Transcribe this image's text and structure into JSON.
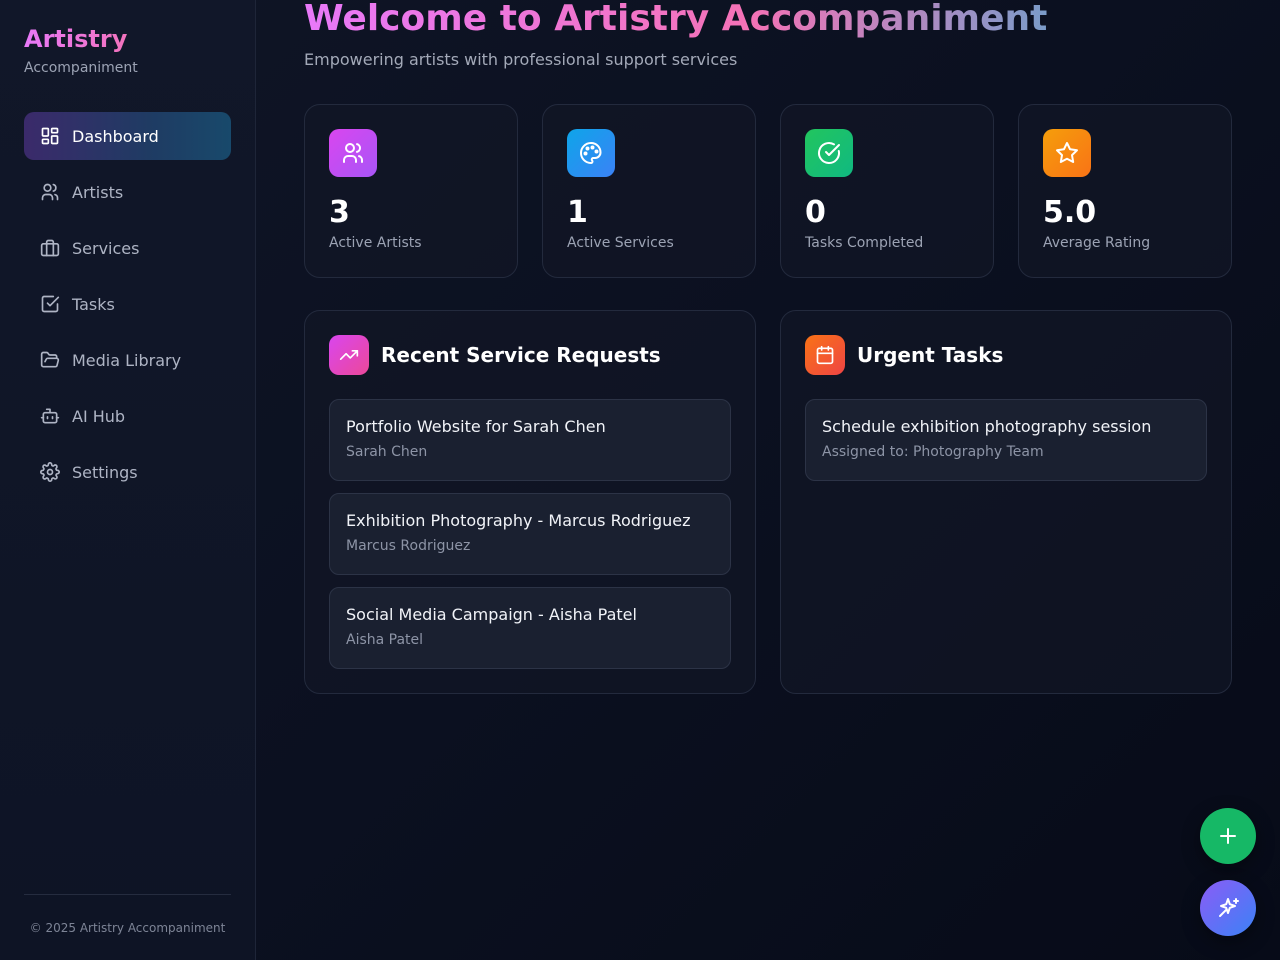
{
  "brand": {
    "title": "Artistry",
    "subtitle": "Accompaniment"
  },
  "sidebar": {
    "items": [
      {
        "label": "Dashboard",
        "icon": "layout-dashboard-icon",
        "active": true
      },
      {
        "label": "Artists",
        "icon": "users-icon"
      },
      {
        "label": "Services",
        "icon": "briefcase-icon"
      },
      {
        "label": "Tasks",
        "icon": "checkbox-icon"
      },
      {
        "label": "Media Library",
        "icon": "folder-open-icon"
      },
      {
        "label": "AI Hub",
        "icon": "bot-icon"
      },
      {
        "label": "Settings",
        "icon": "gear-icon"
      }
    ],
    "footer": "© 2025 Artistry Accompaniment"
  },
  "header": {
    "title": "Welcome to Artistry Accompaniment",
    "subtitle": "Empowering artists with professional support services"
  },
  "stats": [
    {
      "value": "3",
      "label": "Active Artists",
      "icon": "users-icon",
      "color": "#c84fe0"
    },
    {
      "value": "1",
      "label": "Active Services",
      "icon": "palette-icon",
      "color": "#2a8ce0"
    },
    {
      "value": "0",
      "label": "Tasks Completed",
      "icon": "check-circle-icon",
      "color": "#13b86a"
    },
    {
      "value": "5.0",
      "label": "Average Rating",
      "icon": "star-icon",
      "color": "#f07c12"
    }
  ],
  "recent_requests": {
    "title": "Recent Service Requests",
    "icon": "trending-up-icon",
    "items": [
      {
        "title": "Portfolio Website for Sarah Chen",
        "artist": "Sarah Chen"
      },
      {
        "title": "Exhibition Photography - Marcus Rodriguez",
        "artist": "Marcus Rodriguez"
      },
      {
        "title": "Social Media Campaign - Aisha Patel",
        "artist": "Aisha Patel"
      }
    ]
  },
  "urgent_tasks": {
    "title": "Urgent Tasks",
    "icon": "calendar-icon",
    "items": [
      {
        "title": "Schedule exhibition photography session",
        "assigned": "Assigned to: Photography Team"
      }
    ]
  },
  "fabs": [
    {
      "icon": "plus-icon",
      "color": "#16b866"
    },
    {
      "icon": "sparkles-icon",
      "color": "#7b61e8"
    }
  ]
}
